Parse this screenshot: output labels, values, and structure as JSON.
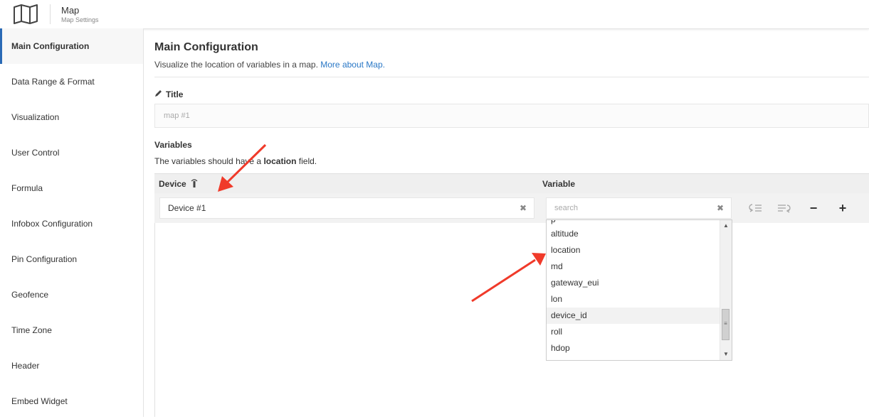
{
  "header": {
    "icon": "map-icon",
    "title": "Map",
    "subtitle": "Map Settings"
  },
  "sidebar": {
    "items": [
      {
        "label": "Main Configuration",
        "active": true
      },
      {
        "label": "Data Range & Format"
      },
      {
        "label": "Visualization"
      },
      {
        "label": "User Control"
      },
      {
        "label": "Formula"
      },
      {
        "label": "Infobox Configuration"
      },
      {
        "label": "Pin Configuration"
      },
      {
        "label": "Geofence"
      },
      {
        "label": "Time Zone"
      },
      {
        "label": "Header"
      },
      {
        "label": "Embed Widget"
      }
    ]
  },
  "main": {
    "title": "Main Configuration",
    "description": "Visualize the location of variables in a map.",
    "more_link": "More about Map.",
    "title_field": {
      "label": "Title",
      "placeholder": "map #1"
    },
    "variables": {
      "label": "Variables",
      "desc_prefix": "The variables should have a",
      "desc_bold": "location",
      "desc_suffix": "field.",
      "columns": {
        "device": "Device",
        "variable": "Variable"
      },
      "row": {
        "device_value": "Device #1",
        "variable_placeholder": "search"
      },
      "dropdown": {
        "items": [
          "altitude",
          "location",
          "md",
          "gateway_eui",
          "lon",
          "device_id",
          "roll",
          "hdop"
        ],
        "hover_item": "device_id"
      }
    }
  },
  "colors": {
    "accent": "#2a6ab5",
    "link": "#2a78c6",
    "annotation": "#f03a2a"
  }
}
